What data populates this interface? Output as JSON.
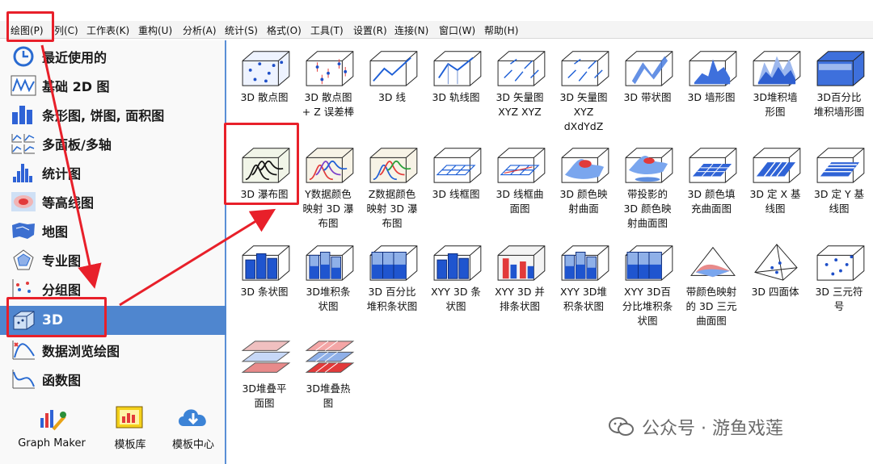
{
  "menubar": {
    "items": [
      "绘图(P)",
      "列(C)",
      "工作表(K)",
      "重构(U)",
      "分析(A)",
      "统计(S)",
      "格式(O)",
      "工具(T)",
      "设置(R)",
      "连接(N)",
      "窗口(W)",
      "帮助(H)"
    ]
  },
  "nav": {
    "items": [
      {
        "label": "最近使用的",
        "icon": "clock-icon"
      },
      {
        "label": "基础 2D 图",
        "icon": "line-wave-icon"
      },
      {
        "label": "条形图, 饼图, 面积图",
        "icon": "bar-chart-icon"
      },
      {
        "label": "多面板/多轴",
        "icon": "multi-panel-icon"
      },
      {
        "label": "统计图",
        "icon": "histogram-icon"
      },
      {
        "label": "等高线图",
        "icon": "contour-icon"
      },
      {
        "label": "地图",
        "icon": "map-icon"
      },
      {
        "label": "专业图",
        "icon": "radar-icon"
      },
      {
        "label": "分组图",
        "icon": "group-plot-icon"
      },
      {
        "label": "3D",
        "icon": "3d-box-icon",
        "active": true
      },
      {
        "label": "数据浏览绘图",
        "icon": "data-explore-icon"
      },
      {
        "label": "函数图",
        "icon": "function-plot-icon"
      }
    ]
  },
  "bottom_tools": [
    {
      "label": "Graph Maker",
      "icon": "graph-maker-icon"
    },
    {
      "label": "模板库",
      "icon": "template-library-icon"
    },
    {
      "label": "模板中心",
      "icon": "cloud-download-icon"
    }
  ],
  "tiles": [
    {
      "label": "3D 散点图",
      "icon": "scatter-3d-icon"
    },
    {
      "label": "3D 散点图\n+ Z 误差棒",
      "icon": "scatter-error-3d-icon"
    },
    {
      "label": "3D 线",
      "icon": "line-3d-icon"
    },
    {
      "label": "3D 轨线图",
      "icon": "trajectory-3d-icon"
    },
    {
      "label": "3D 矢量图\nXYZ XYZ",
      "icon": "vector-xyz-icon"
    },
    {
      "label": "3D 矢量图\nXYZ\ndXdYdZ",
      "icon": "vector-dxdydz-icon"
    },
    {
      "label": "3D 带状图",
      "icon": "ribbon-3d-icon"
    },
    {
      "label": "3D 墙形图",
      "icon": "wall-3d-icon"
    },
    {
      "label": "3D堆积墙\n形图",
      "icon": "stacked-wall-icon"
    },
    {
      "label": "3D百分比\n堆积墙形图",
      "icon": "percent-stacked-wall-icon"
    },
    {
      "label": "3D 瀑布图",
      "icon": "waterfall-3d-icon"
    },
    {
      "label": "Y数据颜色\n映射 3D 瀑\n布图",
      "icon": "waterfall-y-color-icon"
    },
    {
      "label": "Z数据颜色\n映射 3D 瀑\n布图",
      "icon": "waterfall-z-color-icon"
    },
    {
      "label": "3D 线框图",
      "icon": "wireframe-3d-icon"
    },
    {
      "label": "3D 线框曲\n面图",
      "icon": "wireframe-surface-icon"
    },
    {
      "label": "3D 颜色映\n射曲面",
      "icon": "colormap-surface-icon"
    },
    {
      "label": "带投影的\n3D 颜色映\n射曲面图",
      "icon": "projected-surface-icon"
    },
    {
      "label": "3D 颜色填\n充曲面图",
      "icon": "color-fill-surface-icon"
    },
    {
      "label": "3D 定 X 基\n线图",
      "icon": "x-baseline-icon"
    },
    {
      "label": "3D 定 Y 基\n线图",
      "icon": "y-baseline-icon"
    },
    {
      "label": "3D 条状图",
      "icon": "bars-3d-icon"
    },
    {
      "label": "3D堆积条\n状图",
      "icon": "stacked-bars-3d-icon"
    },
    {
      "label": "3D 百分比\n堆积条状图",
      "icon": "percent-stacked-bars-icon"
    },
    {
      "label": "XYY 3D 条\n状图",
      "icon": "xyy-bars-icon"
    },
    {
      "label": "XYY 3D 并\n排条状图",
      "icon": "xyy-side-bars-icon"
    },
    {
      "label": "XYY 3D堆\n积条状图",
      "icon": "xyy-stacked-bars-icon"
    },
    {
      "label": "XYY 3D百\n分比堆积条\n状图",
      "icon": "xyy-percent-bars-icon"
    },
    {
      "label": "带颜色映射\n的 3D 三元\n曲面图",
      "icon": "ternary-surface-icon"
    },
    {
      "label": "3D 四面体",
      "icon": "tetrahedron-icon"
    },
    {
      "label": "3D 三元符\n号",
      "icon": "ternary-symbol-icon"
    },
    {
      "label": "3D堆叠平\n面图",
      "icon": "stacked-planes-icon"
    },
    {
      "label": "3D堆叠热\n图",
      "icon": "stacked-heatmap-icon"
    }
  ],
  "watermark": {
    "text": "公众号 · 游鱼戏莲",
    "icon": "wechat-icon"
  },
  "colors": {
    "accent": "#4f86cf",
    "annotation": "#e8202a",
    "bar_blue": "#2f63d6"
  }
}
